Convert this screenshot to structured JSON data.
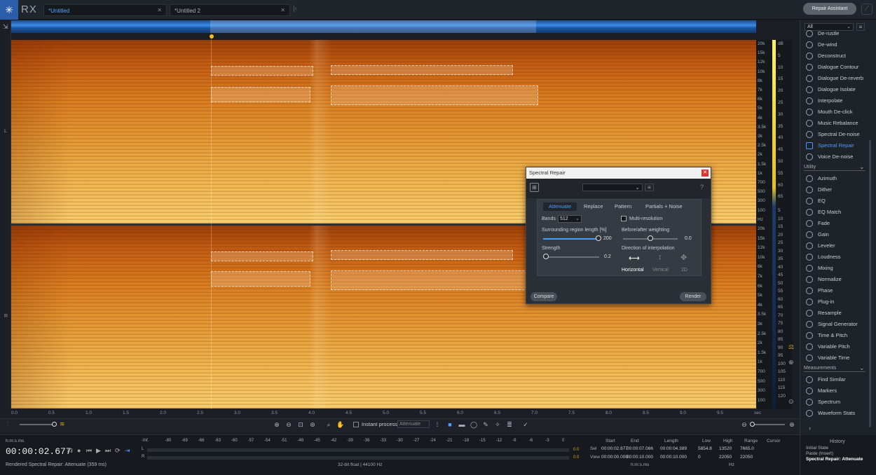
{
  "app": {
    "logo": "RX"
  },
  "tabs": [
    {
      "label": "*Untitled"
    },
    {
      "label": "*Untitled 2"
    }
  ],
  "repair_assistant": "Repair Assistant",
  "channels": {
    "left": "L",
    "right": "R"
  },
  "freq_ticks": [
    "20k",
    "15k",
    "12k",
    "10k",
    "8k",
    "7k",
    "6k",
    "5k",
    "4k",
    "3.5k",
    "3k",
    "2.5k",
    "2k",
    "1.5k",
    "1k",
    "700",
    "500",
    "300",
    "100",
    "Hz",
    "20k",
    "15k",
    "12k",
    "10k",
    "8k",
    "7k",
    "6k",
    "5k",
    "4k",
    "3.5k",
    "3k",
    "2.5k",
    "2k",
    "1.5k",
    "1k",
    "700",
    "500",
    "300",
    "100"
  ],
  "db_ticks": [
    "dB",
    "5",
    "10",
    "15",
    "20",
    "25",
    "30",
    "35",
    "40",
    "45",
    "50",
    "55",
    "60",
    "65",
    "5",
    "10",
    "15",
    "20",
    "25",
    "30",
    "35",
    "40",
    "45",
    "50",
    "55",
    "60",
    "65",
    "70",
    "75",
    "80",
    "85",
    "90",
    "95",
    "100",
    "105",
    "110",
    "115",
    "120"
  ],
  "time_ticks": [
    "0.0",
    "0.5",
    "1.0",
    "1.5",
    "2.0",
    "2.5",
    "3.0",
    "3.5",
    "4.0",
    "4.5",
    "5.0",
    "5.5",
    "6.0",
    "6.5",
    "7.0",
    "7.5",
    "8.0",
    "8.5",
    "9.0",
    "9.5",
    "sec"
  ],
  "filter": {
    "value": "All"
  },
  "modules": [
    "De-rustle",
    "De-wind",
    "Deconstruct",
    "Dialogue Contour",
    "Dialogue De-reverb",
    "Dialogue Isolate",
    "Interpolate",
    "Mouth De-click",
    "Music Rebalance",
    "Spectral De-noise",
    "Spectral Repair",
    "Voice De-noise"
  ],
  "utility_header": "Utility",
  "utility": [
    "Azimuth",
    "Dither",
    "EQ",
    "EQ Match",
    "Fade",
    "Gain",
    "Leveler",
    "Loudness",
    "Mixing",
    "Normalize",
    "Phase",
    "Plug-in",
    "Resample",
    "Signal Generator",
    "Time & Pitch",
    "Variable Pitch",
    "Variable Time"
  ],
  "measurements_header": "Measurements",
  "measurements": [
    "Find Similar",
    "Markers",
    "Spectrum",
    "Waveform Stats"
  ],
  "dialog": {
    "title": "Spectral Repair",
    "help": "?",
    "tabs": [
      "Attenuate",
      "Replace",
      "Pattern",
      "Partials + Noise"
    ],
    "bands_label": "Bands",
    "bands_value": "512",
    "multires_label": "Multi-resolution",
    "surround_label": "Surrounding region length [%]",
    "surround_value": "200",
    "surround_fraction": 1.0,
    "before_after_label": "Before/after weighting",
    "before_after_value": "0.0",
    "before_after_fraction": 0.5,
    "strength_label": "Strength",
    "strength_value": "0.2",
    "strength_fraction": 0.02,
    "direction_label": "Direction of interpolation",
    "directions": [
      "Horizontal",
      "Vertical",
      "2D"
    ],
    "compare": "Compare",
    "render": "Render"
  },
  "toolbar": {
    "instant_process": "Instant process",
    "mode": "Attenuate"
  },
  "status": {
    "time_format": "h:m:s.ms",
    "time": "00:00:02.677",
    "message": "Rendered Spectral Repair: Attenuate (359 ms)",
    "meter_ticks": [
      "-Inf.",
      "-80",
      "-69",
      "-66",
      "-63",
      "-60",
      "-57",
      "-54",
      "-51",
      "-48",
      "-45",
      "-42",
      "-39",
      "-36",
      "-33",
      "-30",
      "-27",
      "-24",
      "-21",
      "-18",
      "-15",
      "-12",
      "-9",
      "-6",
      "-3",
      "0"
    ],
    "meter_L": "L",
    "meter_R": "R",
    "peak_L": "0.0",
    "peak_R": "0.0",
    "format": "32-bit float | 44100 Hz",
    "headers": [
      "Start",
      "End",
      "Length",
      "Low",
      "High",
      "Range",
      "Cursor"
    ],
    "sel_label": "Sel",
    "view_label": "View",
    "sel": [
      "00:00:02.677",
      "00:00:07.066",
      "00:00:04.389",
      "5854.8",
      "13520",
      "7665.0"
    ],
    "view": [
      "00:00:00.000",
      "00:00:10.000",
      "00:00:10.000",
      "0",
      "22050",
      "22050"
    ],
    "unit_time": "h:m:s.ms",
    "unit_hz": "Hz"
  },
  "history": {
    "title": "History",
    "items": [
      "Initial State",
      "Paste (Insert)",
      "Spectral Repair: Attenuate"
    ]
  }
}
